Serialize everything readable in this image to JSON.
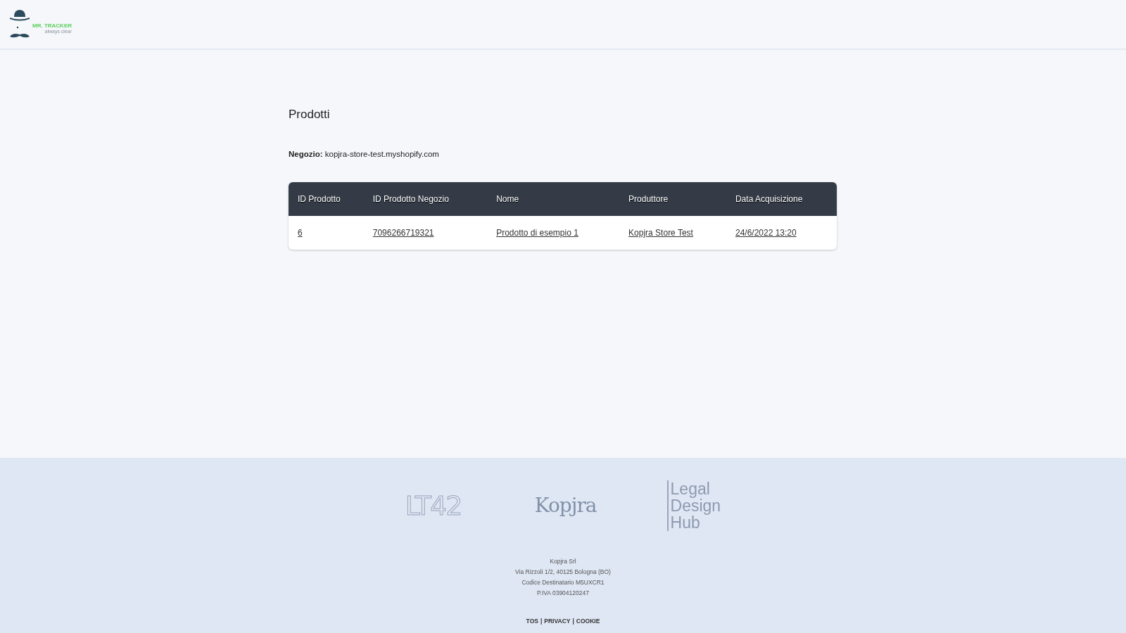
{
  "header": {
    "logo": {
      "name": "MR. TRACKER",
      "tagline": "always clear"
    }
  },
  "page": {
    "title": "Prodotti",
    "store": {
      "label": "Negozio:",
      "value": "kopjra-store-test.myshopify.com"
    }
  },
  "table": {
    "columns": [
      "ID Prodotto",
      "ID Prodotto Negozio",
      "Nome",
      "Produttore",
      "Data Acquisizione"
    ],
    "rows": [
      [
        "6",
        "7096266719321",
        "Prodotto di esempio 1",
        "Kopjra Store Test",
        "24/6/2022 13:20"
      ]
    ]
  },
  "footer": {
    "partners": [
      {
        "kind": "lt42",
        "text": "LT42"
      },
      {
        "kind": "kopjra",
        "text": "Kopjra"
      },
      {
        "kind": "ldh",
        "lines": [
          "Legal",
          "Design",
          "Hub"
        ]
      }
    ],
    "company": [
      "Kopjra Srl",
      "Via Rizzoli 1/2, 40125 Bologna (BO)",
      "Codice Destinatario M5UXCR1",
      "P.IVA 03904120247"
    ],
    "links": [
      "TOS",
      "PRIVACY",
      "COOKIE"
    ],
    "separator": "|"
  }
}
